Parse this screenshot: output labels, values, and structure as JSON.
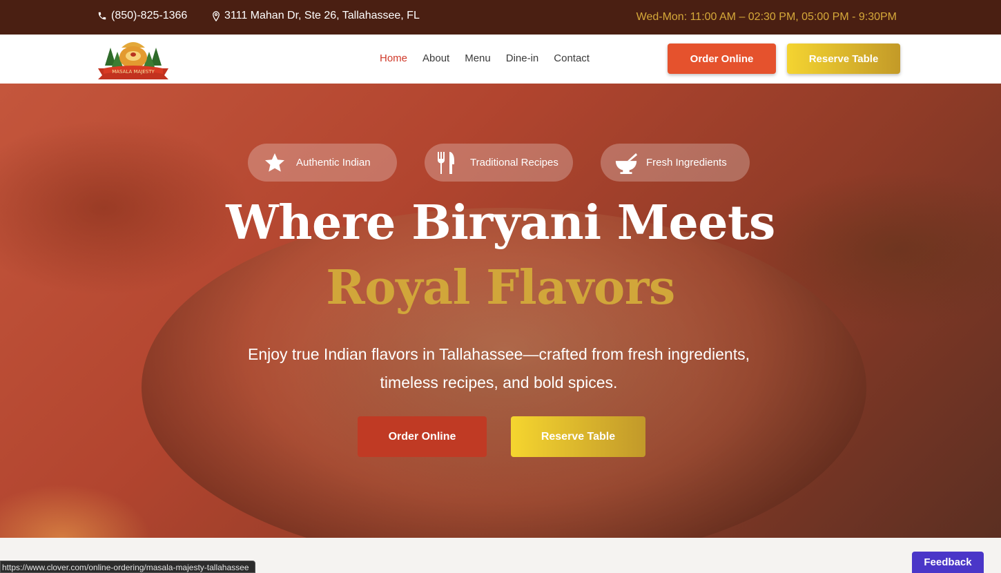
{
  "topbar": {
    "phone": "(850)-825-1366",
    "address": "3111 Mahan Dr, Ste 26, Tallahassee, FL",
    "hours": "Wed-Mon: 11:00 AM – 02:30 PM, 05:00 PM - 9:30PM"
  },
  "nav": {
    "logo_text": "MASALA MAJESTY",
    "items": [
      {
        "label": "Home",
        "active": true
      },
      {
        "label": "About"
      },
      {
        "label": "Menu"
      },
      {
        "label": "Dine-in"
      },
      {
        "label": "Contact"
      }
    ],
    "order_label": "Order Online",
    "reserve_label": "Reserve Table"
  },
  "hero": {
    "pills": [
      {
        "label": "Authentic Indian",
        "icon": "star-icon"
      },
      {
        "label": "Traditional Recipes",
        "icon": "fork-knife-icon"
      },
      {
        "label": "Fresh Ingredients",
        "icon": "mortar-pestle-icon"
      }
    ],
    "title_line1": "Where Biryani Meets",
    "title_line2": "Royal Flavors",
    "subtitle": "Enjoy true Indian flavors in Tallahassee—crafted from fresh ingredients, timeless recipes, and bold spices.",
    "order_label": "Order Online",
    "reserve_label": "Reserve Table"
  },
  "status_url": "https://www.clover.com/online-ordering/masala-majesty-tallahassee",
  "feedback_label": "Feedback",
  "colors": {
    "topbar_bg": "#4a1f12",
    "accent_red": "#e5522d",
    "accent_gold": "#d1a63a",
    "feedback": "#4a36c8"
  }
}
